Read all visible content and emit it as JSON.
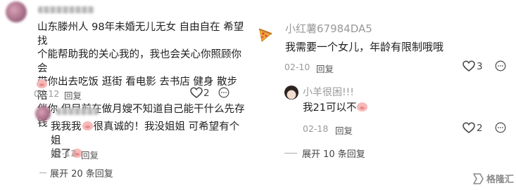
{
  "left": {
    "main_comment": {
      "text_lines": [
        "山东滕州人 98年未婚无儿无女 自由自在 希望找",
        "个能帮助我的关心我的，我也会关心你照顾你 会",
        "带你出去吃饭 逛街 看电影 去书店 健身 散步 陪",
        "伴你 但目前在做月嫂不知道自己能干什么先存钱"
      ],
      "date": "02-12",
      "reply_label": "回复",
      "likes": "2"
    },
    "reply": {
      "line1_a": "我我我",
      "line1_b": "很真诚的！我没姐姐 可希望有个姐",
      "line2": "姐了",
      "date": "02-12",
      "reply_label": "回复"
    },
    "expand_label": "展开 20 条回复"
  },
  "right": {
    "main_comment": {
      "author": "小红薯67984DA5",
      "text": "我需要一个女儿，年龄有限制哦哦",
      "date": "02-10",
      "reply_label": "回复",
      "likes": "3"
    },
    "reply": {
      "author": "小羊很困!!!",
      "text": "我21可以不",
      "date": "02-18",
      "reply_label": "回复",
      "likes": "2"
    },
    "expand_label": "展开 10 条回复"
  },
  "watermark": {
    "text": "格隆汇"
  }
}
